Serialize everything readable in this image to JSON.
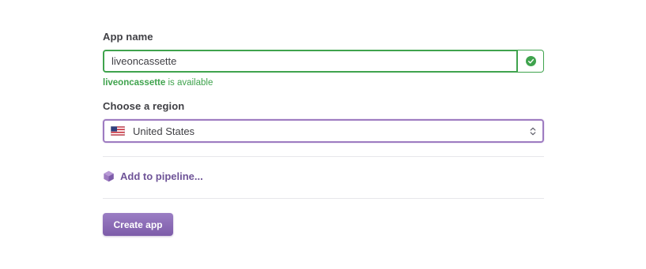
{
  "app_name": {
    "label": "App name",
    "value": "liveoncassette",
    "status_icon": "check-circle-icon",
    "availability_name": "liveoncassette",
    "availability_suffix": " is available"
  },
  "region": {
    "label": "Choose a region",
    "flag_icon": "us-flag-icon",
    "selected": "United States",
    "chevron_icon": "select-chevron-icon"
  },
  "pipeline": {
    "icon": "pipeline-icon",
    "label": "Add to pipeline..."
  },
  "actions": {
    "create_label": "Create app"
  },
  "colors": {
    "success": "#3fa34d",
    "accent": "#9e7cc1",
    "link": "#6f5498",
    "button_top": "#9b7ec4",
    "button_bottom": "#7d5ca9"
  }
}
